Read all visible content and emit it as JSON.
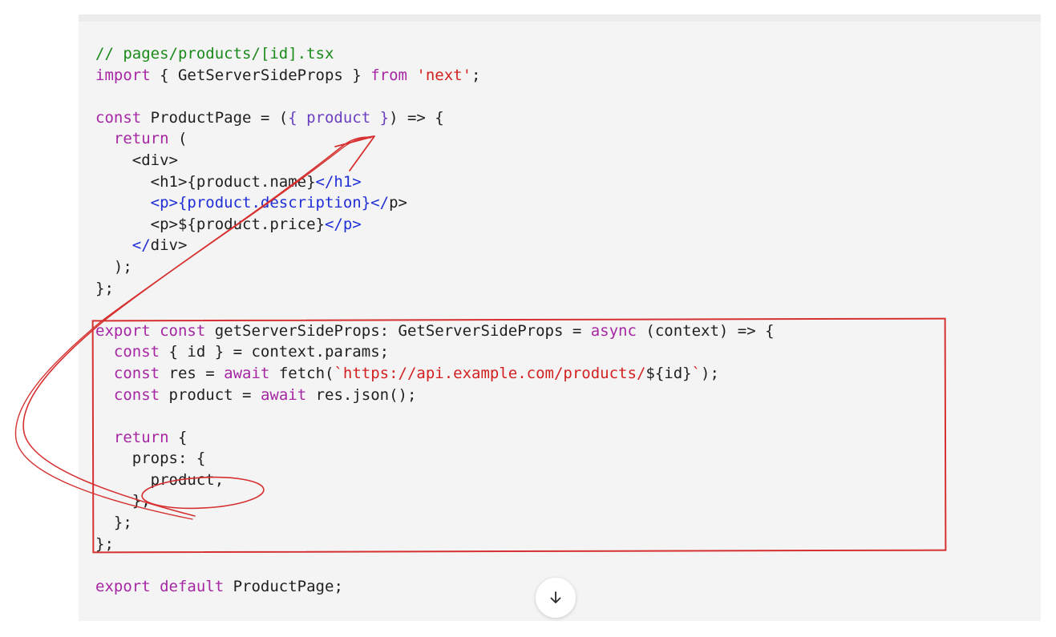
{
  "code": {
    "lines": [
      [
        {
          "t": "// pages/products/[id].tsx",
          "c": "comment"
        }
      ],
      [
        {
          "t": "import",
          "c": "keyword"
        },
        {
          "t": " { GetServerSideProps } ",
          "c": "default"
        },
        {
          "t": "from",
          "c": "keyword"
        },
        {
          "t": " ",
          "c": "default"
        },
        {
          "t": "'next'",
          "c": "string"
        },
        {
          "t": ";",
          "c": "default"
        }
      ],
      [],
      [
        {
          "t": "const",
          "c": "keyword"
        },
        {
          "t": " ProductPage = (",
          "c": "default"
        },
        {
          "t": "{ product }",
          "c": "param"
        },
        {
          "t": ") => {",
          "c": "default"
        }
      ],
      [
        {
          "t": "  ",
          "c": "default"
        },
        {
          "t": "return",
          "c": "keyword"
        },
        {
          "t": " (",
          "c": "default"
        }
      ],
      [
        {
          "t": "    <div>",
          "c": "default"
        }
      ],
      [
        {
          "t": "      <h1>{product.name}",
          "c": "default"
        },
        {
          "t": "</h1>",
          "c": "tag"
        }
      ],
      [
        {
          "t": "      ",
          "c": "default"
        },
        {
          "t": "<p>{product.description}</",
          "c": "tag"
        },
        {
          "t": "p>",
          "c": "default"
        }
      ],
      [
        {
          "t": "      <p>${product.price}",
          "c": "default"
        },
        {
          "t": "</p>",
          "c": "tag"
        }
      ],
      [
        {
          "t": "    ",
          "c": "default"
        },
        {
          "t": "</",
          "c": "tag"
        },
        {
          "t": "div>",
          "c": "default"
        }
      ],
      [
        {
          "t": "  );",
          "c": "default"
        }
      ],
      [
        {
          "t": "};",
          "c": "default"
        }
      ],
      [],
      [
        {
          "t": "export",
          "c": "keyword"
        },
        {
          "t": " ",
          "c": "default"
        },
        {
          "t": "const",
          "c": "keyword"
        },
        {
          "t": " getServerSideProps: GetServerSideProps = ",
          "c": "default"
        },
        {
          "t": "async",
          "c": "keyword"
        },
        {
          "t": " (context) => {",
          "c": "default"
        }
      ],
      [
        {
          "t": "  ",
          "c": "default"
        },
        {
          "t": "const",
          "c": "keyword"
        },
        {
          "t": " { id } = context.params;",
          "c": "default"
        }
      ],
      [
        {
          "t": "  ",
          "c": "default"
        },
        {
          "t": "const",
          "c": "keyword"
        },
        {
          "t": " res = ",
          "c": "default"
        },
        {
          "t": "await",
          "c": "keyword"
        },
        {
          "t": " fetch(",
          "c": "default"
        },
        {
          "t": "`https://api.example.com/products/",
          "c": "string"
        },
        {
          "t": "${id}",
          "c": "default"
        },
        {
          "t": "`",
          "c": "string"
        },
        {
          "t": ");",
          "c": "default"
        }
      ],
      [
        {
          "t": "  ",
          "c": "default"
        },
        {
          "t": "const",
          "c": "keyword"
        },
        {
          "t": " product = ",
          "c": "default"
        },
        {
          "t": "await",
          "c": "keyword"
        },
        {
          "t": " res.json();",
          "c": "default"
        }
      ],
      [],
      [
        {
          "t": "  ",
          "c": "default"
        },
        {
          "t": "return",
          "c": "keyword"
        },
        {
          "t": " {",
          "c": "default"
        }
      ],
      [
        {
          "t": "    props: {",
          "c": "default"
        }
      ],
      [
        {
          "t": "      product,",
          "c": "default"
        }
      ],
      [
        {
          "t": "    },",
          "c": "default"
        }
      ],
      [
        {
          "t": "  };",
          "c": "default"
        }
      ],
      [
        {
          "t": "};",
          "c": "default"
        }
      ],
      [],
      [
        {
          "t": "export",
          "c": "keyword"
        },
        {
          "t": " ",
          "c": "default"
        },
        {
          "t": "default",
          "c": "keyword"
        },
        {
          "t": " ProductPage;",
          "c": "default"
        }
      ]
    ]
  },
  "colors": {
    "comment": "#1a8a1a",
    "keyword": "#a626a4",
    "string": "#d22121",
    "tag": "#1f2fd6",
    "param": "#6a3fbf",
    "annotation": "#d63030",
    "panel_background": "#f4f4f4"
  },
  "scroll_button": {
    "icon": "arrow-down-icon"
  }
}
